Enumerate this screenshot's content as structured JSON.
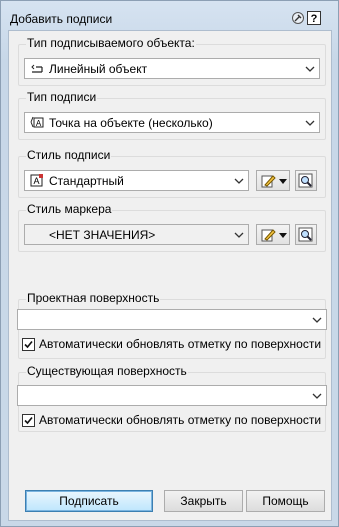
{
  "window": {
    "title": "Добавить подписи"
  },
  "groups": {
    "object_type": {
      "label": "Тип подписываемого объекта:",
      "value": "Линейный объект",
      "icon": "line-object-icon"
    },
    "label_type": {
      "label": "Тип подписи",
      "value": "Точка на объекте (несколько)",
      "icon": "label-type-icon"
    },
    "label_style": {
      "label": "Стиль подписи",
      "value": "Стандартный",
      "icon": "label-style-icon"
    },
    "marker_style": {
      "label": "Стиль маркера",
      "value": "<НЕТ ЗНАЧЕНИЯ>"
    },
    "design_surface": {
      "label": "Проектная поверхность",
      "value": "",
      "checkbox_label": "Автоматически обновлять отметку по поверхности",
      "checked": true
    },
    "existing_surface": {
      "label": "Существующая поверхность",
      "value": "",
      "checkbox_label": "Автоматически обновлять отметку по поверхности",
      "checked": true
    }
  },
  "buttons": {
    "label": "Подписать",
    "close": "Закрыть",
    "help": "Помощь"
  }
}
